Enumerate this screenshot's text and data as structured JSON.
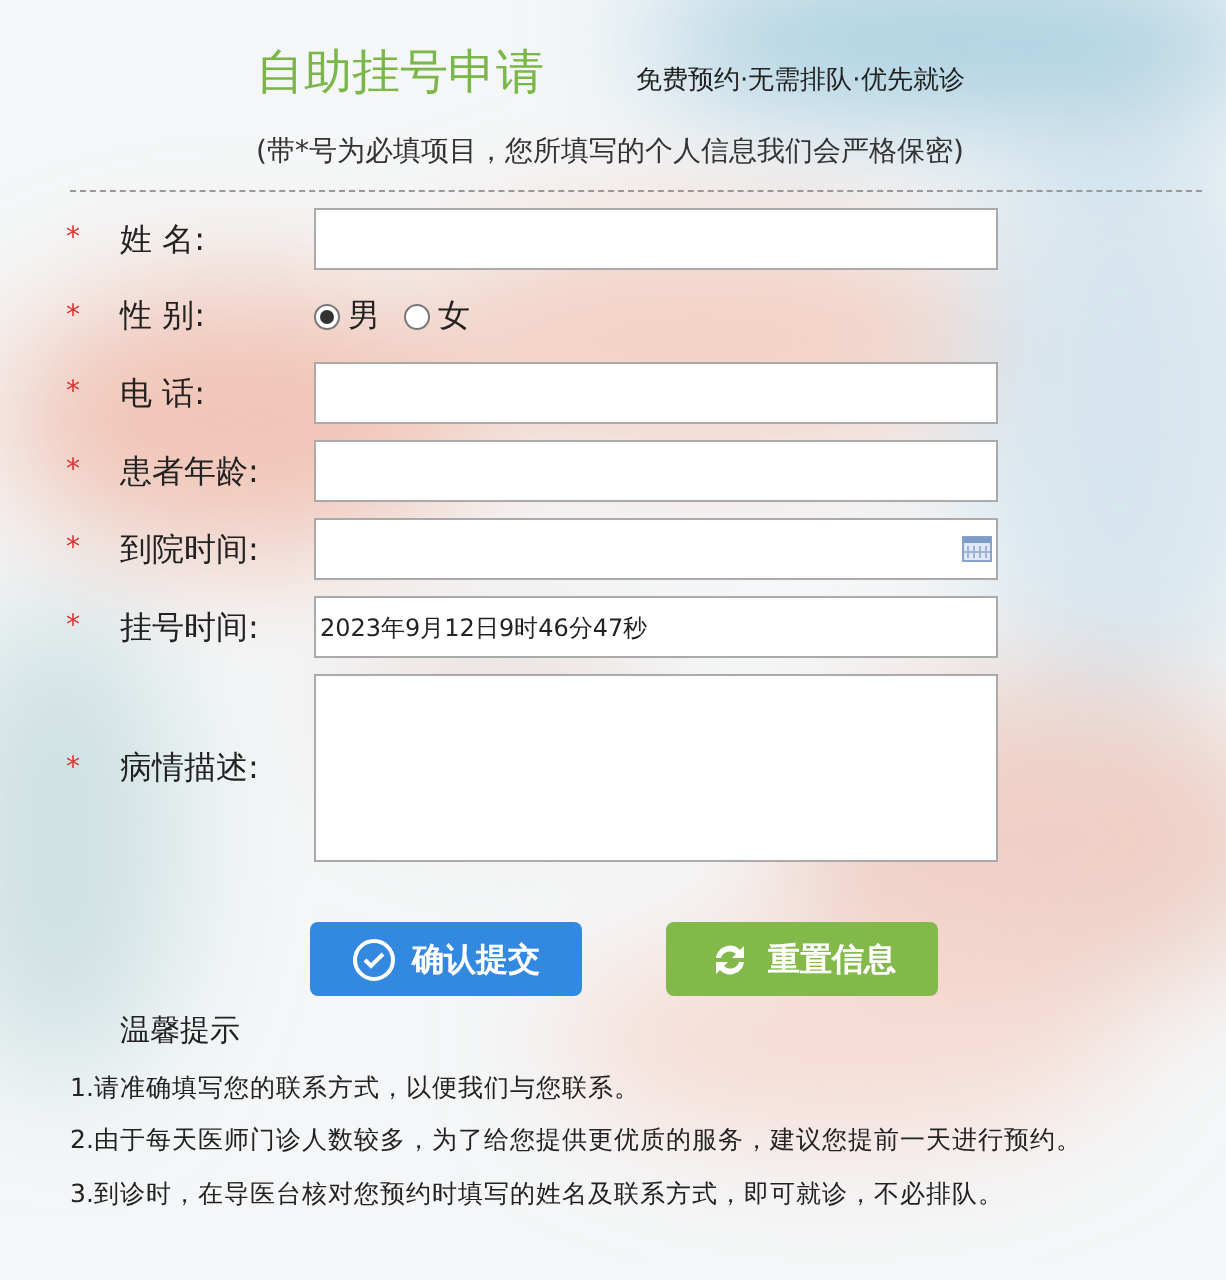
{
  "title": "自助挂号申请",
  "slogan": "免费预约·无需排队·优先就诊",
  "note": "(带*号为必填项目，您所填写的个人信息我们会严格保密)",
  "fields": [
    {
      "kind": "text",
      "required_mark": "*",
      "label": "姓 名:"
    },
    {
      "kind": "radio",
      "required_mark": "*",
      "label": "性 别:",
      "options": [
        {
          "label": "男",
          "selected": true
        },
        {
          "label": "女",
          "selected": false
        }
      ]
    },
    {
      "kind": "text",
      "required_mark": "*",
      "label": "电 话:"
    },
    {
      "kind": "text",
      "required_mark": "*",
      "label": "患者年龄:"
    },
    {
      "kind": "date",
      "required_mark": "*",
      "label": "到院时间:"
    },
    {
      "kind": "text",
      "required_mark": "*",
      "label": "挂号时间:",
      "value": "2023年9月12日9时46分47秒"
    },
    {
      "kind": "textarea",
      "required_mark": "*",
      "label": "病情描述:"
    }
  ],
  "buttons": [
    {
      "kind": "submit",
      "label": "确认提交"
    },
    {
      "kind": "reset",
      "label": "重置信息"
    }
  ],
  "tips": {
    "title": "温馨提示",
    "items": [
      "1.请准确填写您的联系方式，以便我们与您联系。",
      "2.由于每天医师门诊人数较多，为了给您提供更优质的服务，建议您提前一天进行预约。",
      "3.到诊时，在导医台核对您预约时填写的姓名及联系方式，即可就诊，不必排队。"
    ]
  }
}
